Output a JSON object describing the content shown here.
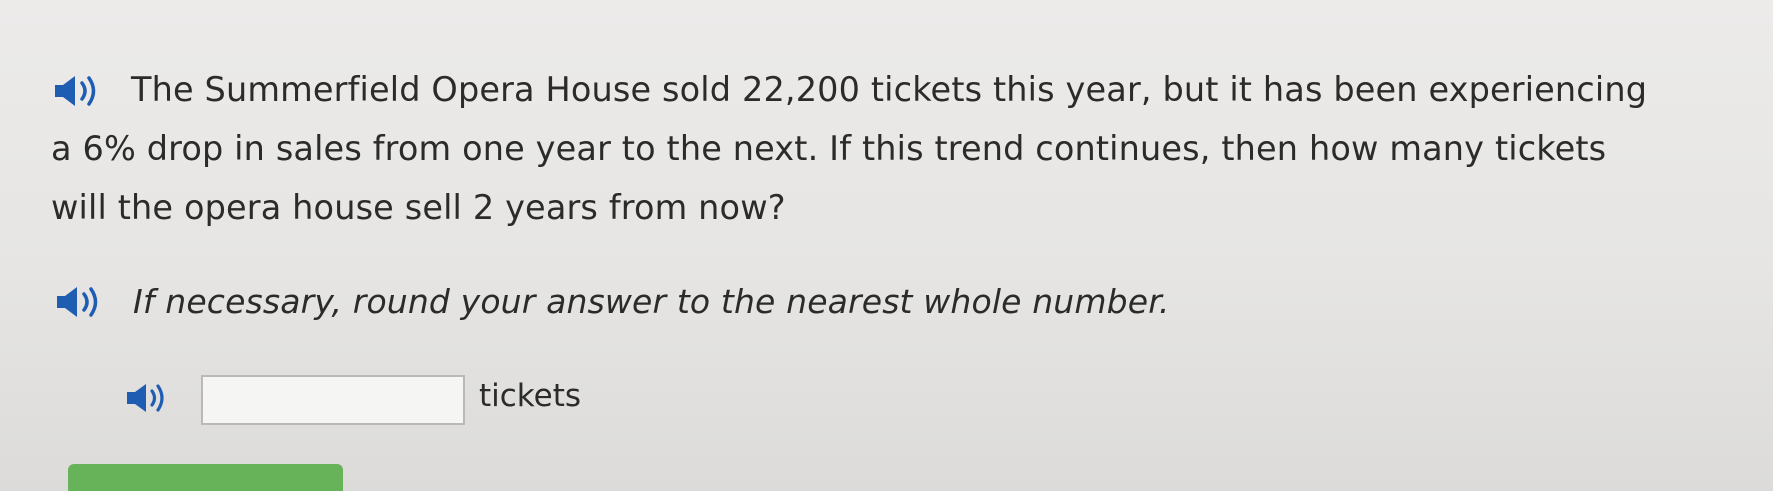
{
  "question": {
    "line1": "The Summerfield Opera House sold 22,200 tickets this year, but it has been experiencing",
    "line2": "a 6% drop in sales from one year to the next. If this trend continues, then how many tickets",
    "line3": "will the opera house sell 2 years from now?"
  },
  "hint": "If necessary, round your answer to the nearest whole number.",
  "answer": {
    "value": "",
    "unit": "tickets"
  },
  "icons": {
    "audio": "speaker-icon"
  },
  "colors": {
    "text": "#2b2b2b",
    "speaker_blue": "#1f5db3",
    "button_green": "#66b35a"
  }
}
